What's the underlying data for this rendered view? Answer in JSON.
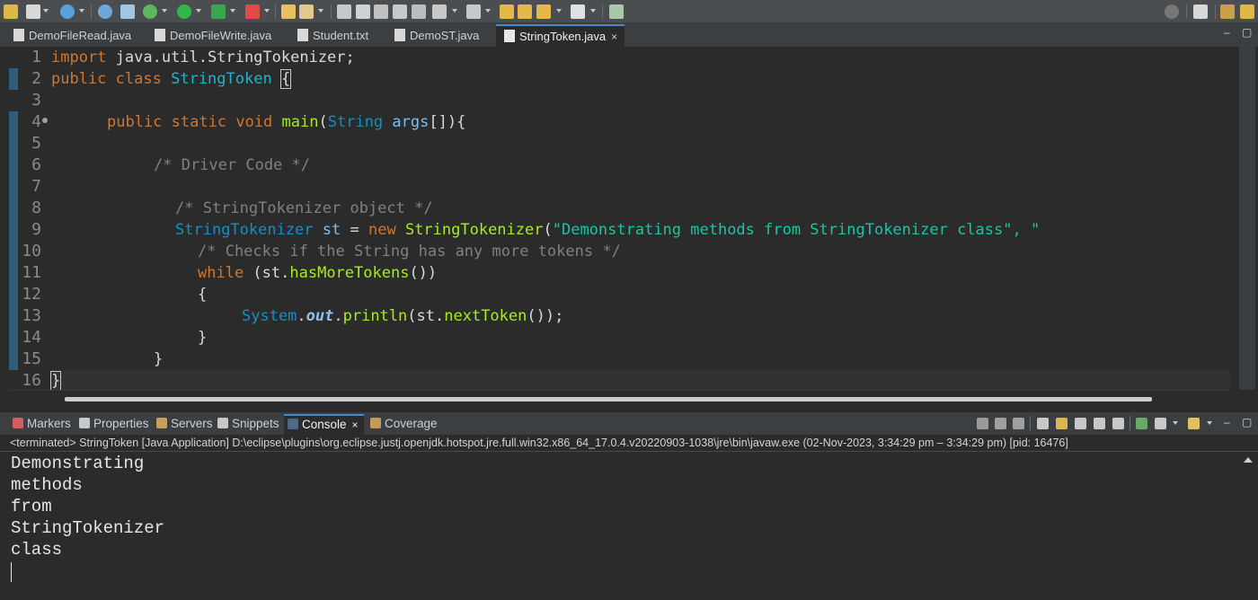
{
  "editor_tabs": [
    {
      "label": "DemoFileRead.java",
      "active": false
    },
    {
      "label": "DemoFileWrite.java",
      "active": false
    },
    {
      "label": "Student.txt",
      "active": false
    },
    {
      "label": "DemoST.java",
      "active": false
    },
    {
      "label": "StringToken.java",
      "active": true
    }
  ],
  "close_glyph": "×",
  "min_glyph": "–",
  "max_glyph": "▢",
  "line_numbers": [
    "1",
    "2",
    "3",
    "4",
    "5",
    "6",
    "7",
    "8",
    "9",
    "10",
    "11",
    "12",
    "13",
    "14",
    "15",
    "16"
  ],
  "code": {
    "l1": {
      "kw": "import",
      "rest": " java.util.StringTokenizer;"
    },
    "l2": {
      "kw1": "public",
      "kw2": "class",
      "cls": "StringToken",
      "brace": "{"
    },
    "l4": {
      "kw1": "public",
      "kw2": "static",
      "kw3": "void",
      "fn": "main",
      "open": "(",
      "type": "String",
      "param": "args",
      "close": "[]){"
    },
    "l6": {
      "comment": "/* Driver Code */"
    },
    "l8": {
      "comment": "/* StringTokenizer object */"
    },
    "l9": {
      "type": "StringTokenizer",
      "var": "st",
      "eq": " = ",
      "kw": "new",
      "cls": "StringTokenizer",
      "open": "(",
      "str": "\"Demonstrating methods from StringTokenizer class\"",
      "tail": ", \""
    },
    "l10": {
      "comment": "/* Checks if the String has any more tokens */"
    },
    "l11": {
      "kw": "while",
      "open": " (st.",
      "fn": "hasMoreTokens",
      "close": "())"
    },
    "l12": {
      "text": "{"
    },
    "l13": {
      "cls": "System",
      "dot1": ".",
      "field": "out",
      "dot2": ".",
      "fn1": "println",
      "open": "(st.",
      "fn2": "nextToken",
      "close": "());"
    },
    "l14": {
      "text": "}"
    },
    "l15": {
      "text": "}"
    },
    "l16": {
      "text": "}"
    }
  },
  "view_tabs": [
    {
      "label": "Markers",
      "icon": "markers-icon",
      "active": false
    },
    {
      "label": "Properties",
      "icon": "properties-icon",
      "active": false
    },
    {
      "label": "Servers",
      "icon": "servers-icon",
      "active": false
    },
    {
      "label": "Snippets",
      "icon": "snippets-icon",
      "active": false
    },
    {
      "label": "Console",
      "icon": "console-icon",
      "active": true
    },
    {
      "label": "Coverage",
      "icon": "coverage-icon",
      "active": false
    }
  ],
  "console_status": "<terminated> StringToken [Java Application] D:\\eclipse\\plugins\\org.eclipse.justj.openjdk.hotspot.jre.full.win32.x86_64_17.0.4.v20220903-1038\\jre\\bin\\javaw.exe  (02-Nov-2023, 3:34:29 pm – 3:34:29 pm) [pid: 16476]",
  "console_output": [
    "Demonstrating",
    "methods",
    "from",
    "StringTokenizer",
    "class"
  ],
  "colors": {
    "keyword": "#cc7832",
    "type": "#1290c3",
    "string": "#17c6a3",
    "comment": "#808080",
    "method": "#a7ec21",
    "accent": "#4a88c7"
  }
}
